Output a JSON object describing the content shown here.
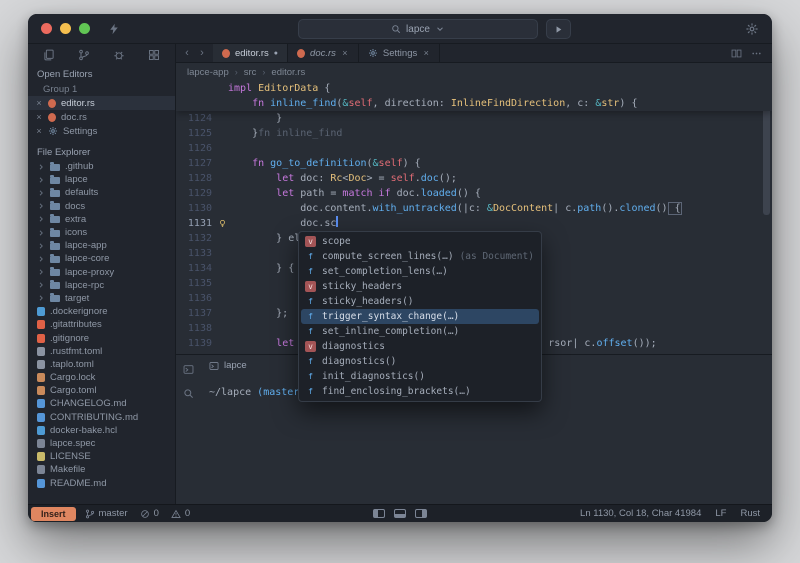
{
  "titlebar": {
    "search": "lapce"
  },
  "activity_icons": [
    "explorer-icon",
    "source-control-icon",
    "debug-icon",
    "extensions-icon"
  ],
  "sidebar": {
    "open_editors": {
      "header": "Open Editors",
      "group": "Group 1",
      "items": [
        {
          "label": "editor.rs",
          "icon": "rust",
          "active": true
        },
        {
          "label": "doc.rs",
          "icon": "rust",
          "active": false
        },
        {
          "label": "Settings",
          "icon": "gear",
          "active": false
        }
      ]
    },
    "file_explorer": {
      "header": "File Explorer",
      "items": [
        {
          "label": ".github",
          "kind": "folder"
        },
        {
          "label": "lapce",
          "kind": "folder"
        },
        {
          "label": "defaults",
          "kind": "folder"
        },
        {
          "label": "docs",
          "kind": "folder"
        },
        {
          "label": "extra",
          "kind": "folder"
        },
        {
          "label": "icons",
          "kind": "folder"
        },
        {
          "label": "lapce-app",
          "kind": "folder"
        },
        {
          "label": "lapce-core",
          "kind": "folder"
        },
        {
          "label": "lapce-proxy",
          "kind": "folder"
        },
        {
          "label": "lapce-rpc",
          "kind": "folder"
        },
        {
          "label": "target",
          "kind": "folder"
        },
        {
          "label": ".dockerignore",
          "kind": "file",
          "icon": "docker"
        },
        {
          "label": ".gitattributes",
          "kind": "file",
          "icon": "git"
        },
        {
          "label": ".gitignore",
          "kind": "file",
          "icon": "git"
        },
        {
          "label": ".rustfmt.toml",
          "kind": "file",
          "icon": "toml"
        },
        {
          "label": ".taplo.toml",
          "kind": "file",
          "icon": "toml"
        },
        {
          "label": "Cargo.lock",
          "kind": "file",
          "icon": "cargo"
        },
        {
          "label": "Cargo.toml",
          "kind": "file",
          "icon": "cargo"
        },
        {
          "label": "CHANGELOG.md",
          "kind": "file",
          "icon": "markdown"
        },
        {
          "label": "CONTRIBUTING.md",
          "kind": "file",
          "icon": "markdown"
        },
        {
          "label": "docker-bake.hcl",
          "kind": "file",
          "icon": "docker"
        },
        {
          "label": "lapce.spec",
          "kind": "file",
          "icon": "plain"
        },
        {
          "label": "LICENSE",
          "kind": "file",
          "icon": "license"
        },
        {
          "label": "Makefile",
          "kind": "file",
          "icon": "plain"
        },
        {
          "label": "README.md",
          "kind": "file",
          "icon": "markdown"
        }
      ]
    }
  },
  "tabs": [
    {
      "label": "editor.rs",
      "icon": "rust",
      "active": true,
      "modified": true
    },
    {
      "label": "doc.rs",
      "icon": "rust",
      "active": false,
      "preview": true,
      "close": true
    },
    {
      "label": "Settings",
      "icon": "gear",
      "active": false,
      "close": true
    }
  ],
  "breadcrumb": [
    "lapce-app",
    "src",
    "editor.rs"
  ],
  "editor": {
    "sticky_lines": [
      {
        "num": "",
        "tokens": [
          {
            "t": "impl ",
            "c": "kw"
          },
          {
            "t": "EditorData",
            "c": "ty"
          },
          {
            "t": " {",
            "c": "txt"
          }
        ]
      },
      {
        "num": "",
        "tokens": [
          {
            "t": "    ",
            "c": "txt"
          },
          {
            "t": "fn ",
            "c": "kw"
          },
          {
            "t": "inline_find",
            "c": "fn"
          },
          {
            "t": "(",
            "c": "txt"
          },
          {
            "t": "&",
            "c": "op"
          },
          {
            "t": "self",
            "c": "var"
          },
          {
            "t": ", direction: ",
            "c": "txt"
          },
          {
            "t": "InlineFindDirection",
            "c": "ty"
          },
          {
            "t": ", c: ",
            "c": "txt"
          },
          {
            "t": "&",
            "c": "op"
          },
          {
            "t": "str",
            "c": "ty"
          },
          {
            "t": ") {",
            "c": "txt"
          }
        ]
      }
    ],
    "lines": [
      {
        "num": "1124",
        "tokens": [
          {
            "t": "        }",
            "c": "txt"
          }
        ]
      },
      {
        "num": "1125",
        "tokens": [
          {
            "t": "    }",
            "c": "txt"
          },
          {
            "t": "fn inline_find",
            "c": "hint"
          }
        ]
      },
      {
        "num": "1126",
        "tokens": []
      },
      {
        "num": "1127",
        "tokens": [
          {
            "t": "    ",
            "c": "txt"
          },
          {
            "t": "fn ",
            "c": "kw"
          },
          {
            "t": "go_to_definition",
            "c": "fn"
          },
          {
            "t": "(",
            "c": "txt"
          },
          {
            "t": "&",
            "c": "op"
          },
          {
            "t": "self",
            "c": "var"
          },
          {
            "t": ") {",
            "c": "txt"
          }
        ]
      },
      {
        "num": "1128",
        "tokens": [
          {
            "t": "        ",
            "c": "txt"
          },
          {
            "t": "let ",
            "c": "kw"
          },
          {
            "t": "doc: ",
            "c": "txt"
          },
          {
            "t": "Rc",
            "c": "ty"
          },
          {
            "t": "<",
            "c": "txt"
          },
          {
            "t": "Doc",
            "c": "ty"
          },
          {
            "t": "> = ",
            "c": "txt"
          },
          {
            "t": "self",
            "c": "var"
          },
          {
            "t": ".",
            "c": "txt"
          },
          {
            "t": "doc",
            "c": "fn"
          },
          {
            "t": "();",
            "c": "txt"
          }
        ]
      },
      {
        "num": "1129",
        "tokens": [
          {
            "t": "        ",
            "c": "txt"
          },
          {
            "t": "let ",
            "c": "kw"
          },
          {
            "t": "path = ",
            "c": "txt"
          },
          {
            "t": "match ",
            "c": "kw"
          },
          {
            "t": "if ",
            "c": "kw"
          },
          {
            "t": "doc.",
            "c": "txt"
          },
          {
            "t": "loaded",
            "c": "fn"
          },
          {
            "t": "() {",
            "c": "txt"
          }
        ]
      },
      {
        "num": "1130",
        "tokens": [
          {
            "t": "            ",
            "c": "txt"
          },
          {
            "t": "doc.content.",
            "c": "txt"
          },
          {
            "t": "with_untracked",
            "c": "fn"
          },
          {
            "t": "(|c: ",
            "c": "txt"
          },
          {
            "t": "&",
            "c": "op"
          },
          {
            "t": "DocContent",
            "c": "ty"
          },
          {
            "t": "| c.",
            "c": "txt"
          },
          {
            "t": "path",
            "c": "fn"
          },
          {
            "t": "().",
            "c": "txt"
          },
          {
            "t": "cloned",
            "c": "fn"
          },
          {
            "t": "()",
            "c": "txt"
          },
          {
            "t": " {",
            "c": "txt",
            "box": true
          }
        ]
      },
      {
        "num": "1131",
        "active": true,
        "bulb": true,
        "tokens": [
          {
            "t": "            doc.sc",
            "c": "txt"
          },
          {
            "caret": true
          }
        ]
      },
      {
        "num": "1132",
        "tokens": [
          {
            "t": "        } el",
            "c": "txt"
          }
        ]
      },
      {
        "num": "1133",
        "tokens": []
      },
      {
        "num": "1134",
        "tokens": [
          {
            "t": "        } {",
            "c": "txt"
          }
        ]
      },
      {
        "num": "1135",
        "tokens": []
      },
      {
        "num": "1136",
        "tokens": []
      },
      {
        "num": "1137",
        "tokens": [
          {
            "t": "        };",
            "c": "txt"
          }
        ]
      },
      {
        "num": "1138",
        "tokens": []
      },
      {
        "num": "1139",
        "tokens": [
          {
            "t": "        ",
            "c": "txt"
          },
          {
            "t": "let ",
            "c": "kw"
          },
          {
            "gap": 248
          },
          {
            "t": "rsor| c.",
            "c": "txt"
          },
          {
            "t": "offset",
            "c": "fn"
          },
          {
            "t": "());",
            "c": "txt"
          }
        ]
      }
    ]
  },
  "completion": {
    "selected": 5,
    "items": [
      {
        "kind": "v",
        "label": "scope"
      },
      {
        "kind": "f",
        "label": "compute_screen_lines(…)",
        "suffix": " (as Document)"
      },
      {
        "kind": "f",
        "label": "set_completion_lens(…)"
      },
      {
        "kind": "v",
        "label": "sticky_headers"
      },
      {
        "kind": "f",
        "label": "sticky_headers()"
      },
      {
        "kind": "f",
        "label": "trigger_syntax_change(…)"
      },
      {
        "kind": "f",
        "label": "set_inline_completion(…)"
      },
      {
        "kind": "v",
        "label": "diagnostics"
      },
      {
        "kind": "f",
        "label": "diagnostics()"
      },
      {
        "kind": "f",
        "label": "init_diagnostics()"
      },
      {
        "kind": "f",
        "label": "find_enclosing_brackets(…)"
      }
    ]
  },
  "terminal": {
    "tab": "lapce",
    "prompt_path": "~/lapce ",
    "prompt_branch": "(master)"
  },
  "statusbar": {
    "mode": "Insert",
    "branch": "master",
    "errors": "0",
    "warnings": "0",
    "position": "Ln 1130, Col 18, Char 41984",
    "eol": "LF",
    "language": "Rust"
  }
}
